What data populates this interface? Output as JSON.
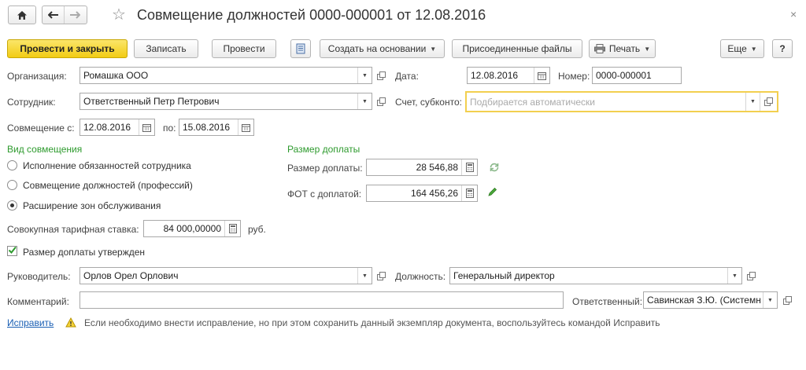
{
  "window": {
    "title": "Совмещение должностей 0000-000001 от 12.08.2016",
    "close": "×"
  },
  "toolbar": {
    "post_close": "Провести и закрыть",
    "save": "Записать",
    "post": "Провести",
    "create_based": "Создать на основании",
    "attached_files": "Присоединенные файлы",
    "print": "Печать",
    "more": "Еще",
    "help": "?"
  },
  "form": {
    "organization": {
      "label": "Организация:",
      "value": "Ромашка ООО"
    },
    "date": {
      "label": "Дата:",
      "value": "12.08.2016"
    },
    "number": {
      "label": "Номер:",
      "value": "0000-000001"
    },
    "employee": {
      "label": "Сотрудник:",
      "value": "Ответственный Петр Петрович"
    },
    "account": {
      "label": "Счет, субконто:",
      "placeholder": "Подбирается автоматически"
    },
    "combo_from": {
      "label": "Совмещение с:",
      "value": "12.08.2016"
    },
    "combo_to": {
      "label": "по:",
      "value": "15.08.2016"
    },
    "kind": {
      "title": "Вид совмещения",
      "options": [
        {
          "label": "Исполнение обязанностей сотрудника",
          "selected": false
        },
        {
          "label": "Совмещение должностей (профессий)",
          "selected": false
        },
        {
          "label": "Расширение зон обслуживания",
          "selected": true
        }
      ]
    },
    "surcharge": {
      "title": "Размер доплаты",
      "amount": {
        "label": "Размер доплаты:",
        "value": "28 546,88"
      },
      "fot": {
        "label": "ФОТ с доплатой:",
        "value": "164 456,26"
      }
    },
    "total_rate": {
      "label": "Совокупная тарифная ставка:",
      "value": "84 000,00000",
      "unit": "руб."
    },
    "approved": {
      "label": "Размер доплаты утвержден",
      "checked": true
    },
    "manager": {
      "label": "Руководитель:",
      "value": "Орлов Орел Орлович"
    },
    "position": {
      "label": "Должность:",
      "value": "Генеральный директор"
    },
    "comment": {
      "label": "Комментарий:",
      "value": ""
    },
    "responsible": {
      "label": "Ответственный:",
      "value": "Савинская З.Ю. (Системн"
    },
    "fix_link": "Исправить",
    "fix_note": "Если необходимо внести исправление, но при этом сохранить данный экземпляр документа, воспользуйтесь командой Исправить"
  },
  "colors": {
    "primary": "#f2cc14",
    "accent_green": "#2d9a2d",
    "link": "#1a5fb4",
    "focus": "#f2cf4f"
  }
}
